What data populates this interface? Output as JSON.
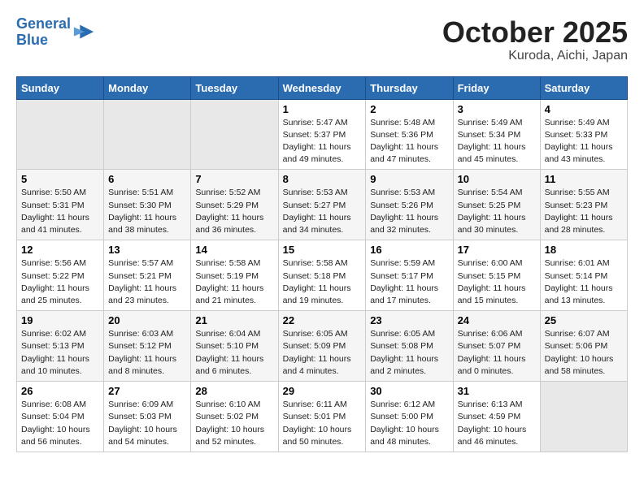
{
  "header": {
    "logo_line1": "General",
    "logo_line2": "Blue",
    "month": "October 2025",
    "location": "Kuroda, Aichi, Japan"
  },
  "weekdays": [
    "Sunday",
    "Monday",
    "Tuesday",
    "Wednesday",
    "Thursday",
    "Friday",
    "Saturday"
  ],
  "weeks": [
    [
      {
        "day": "",
        "info": ""
      },
      {
        "day": "",
        "info": ""
      },
      {
        "day": "",
        "info": ""
      },
      {
        "day": "1",
        "info": "Sunrise: 5:47 AM\nSunset: 5:37 PM\nDaylight: 11 hours and 49 minutes."
      },
      {
        "day": "2",
        "info": "Sunrise: 5:48 AM\nSunset: 5:36 PM\nDaylight: 11 hours and 47 minutes."
      },
      {
        "day": "3",
        "info": "Sunrise: 5:49 AM\nSunset: 5:34 PM\nDaylight: 11 hours and 45 minutes."
      },
      {
        "day": "4",
        "info": "Sunrise: 5:49 AM\nSunset: 5:33 PM\nDaylight: 11 hours and 43 minutes."
      }
    ],
    [
      {
        "day": "5",
        "info": "Sunrise: 5:50 AM\nSunset: 5:31 PM\nDaylight: 11 hours and 41 minutes."
      },
      {
        "day": "6",
        "info": "Sunrise: 5:51 AM\nSunset: 5:30 PM\nDaylight: 11 hours and 38 minutes."
      },
      {
        "day": "7",
        "info": "Sunrise: 5:52 AM\nSunset: 5:29 PM\nDaylight: 11 hours and 36 minutes."
      },
      {
        "day": "8",
        "info": "Sunrise: 5:53 AM\nSunset: 5:27 PM\nDaylight: 11 hours and 34 minutes."
      },
      {
        "day": "9",
        "info": "Sunrise: 5:53 AM\nSunset: 5:26 PM\nDaylight: 11 hours and 32 minutes."
      },
      {
        "day": "10",
        "info": "Sunrise: 5:54 AM\nSunset: 5:25 PM\nDaylight: 11 hours and 30 minutes."
      },
      {
        "day": "11",
        "info": "Sunrise: 5:55 AM\nSunset: 5:23 PM\nDaylight: 11 hours and 28 minutes."
      }
    ],
    [
      {
        "day": "12",
        "info": "Sunrise: 5:56 AM\nSunset: 5:22 PM\nDaylight: 11 hours and 25 minutes."
      },
      {
        "day": "13",
        "info": "Sunrise: 5:57 AM\nSunset: 5:21 PM\nDaylight: 11 hours and 23 minutes."
      },
      {
        "day": "14",
        "info": "Sunrise: 5:58 AM\nSunset: 5:19 PM\nDaylight: 11 hours and 21 minutes."
      },
      {
        "day": "15",
        "info": "Sunrise: 5:58 AM\nSunset: 5:18 PM\nDaylight: 11 hours and 19 minutes."
      },
      {
        "day": "16",
        "info": "Sunrise: 5:59 AM\nSunset: 5:17 PM\nDaylight: 11 hours and 17 minutes."
      },
      {
        "day": "17",
        "info": "Sunrise: 6:00 AM\nSunset: 5:15 PM\nDaylight: 11 hours and 15 minutes."
      },
      {
        "day": "18",
        "info": "Sunrise: 6:01 AM\nSunset: 5:14 PM\nDaylight: 11 hours and 13 minutes."
      }
    ],
    [
      {
        "day": "19",
        "info": "Sunrise: 6:02 AM\nSunset: 5:13 PM\nDaylight: 11 hours and 10 minutes."
      },
      {
        "day": "20",
        "info": "Sunrise: 6:03 AM\nSunset: 5:12 PM\nDaylight: 11 hours and 8 minutes."
      },
      {
        "day": "21",
        "info": "Sunrise: 6:04 AM\nSunset: 5:10 PM\nDaylight: 11 hours and 6 minutes."
      },
      {
        "day": "22",
        "info": "Sunrise: 6:05 AM\nSunset: 5:09 PM\nDaylight: 11 hours and 4 minutes."
      },
      {
        "day": "23",
        "info": "Sunrise: 6:05 AM\nSunset: 5:08 PM\nDaylight: 11 hours and 2 minutes."
      },
      {
        "day": "24",
        "info": "Sunrise: 6:06 AM\nSunset: 5:07 PM\nDaylight: 11 hours and 0 minutes."
      },
      {
        "day": "25",
        "info": "Sunrise: 6:07 AM\nSunset: 5:06 PM\nDaylight: 10 hours and 58 minutes."
      }
    ],
    [
      {
        "day": "26",
        "info": "Sunrise: 6:08 AM\nSunset: 5:04 PM\nDaylight: 10 hours and 56 minutes."
      },
      {
        "day": "27",
        "info": "Sunrise: 6:09 AM\nSunset: 5:03 PM\nDaylight: 10 hours and 54 minutes."
      },
      {
        "day": "28",
        "info": "Sunrise: 6:10 AM\nSunset: 5:02 PM\nDaylight: 10 hours and 52 minutes."
      },
      {
        "day": "29",
        "info": "Sunrise: 6:11 AM\nSunset: 5:01 PM\nDaylight: 10 hours and 50 minutes."
      },
      {
        "day": "30",
        "info": "Sunrise: 6:12 AM\nSunset: 5:00 PM\nDaylight: 10 hours and 48 minutes."
      },
      {
        "day": "31",
        "info": "Sunrise: 6:13 AM\nSunset: 4:59 PM\nDaylight: 10 hours and 46 minutes."
      },
      {
        "day": "",
        "info": ""
      }
    ]
  ]
}
